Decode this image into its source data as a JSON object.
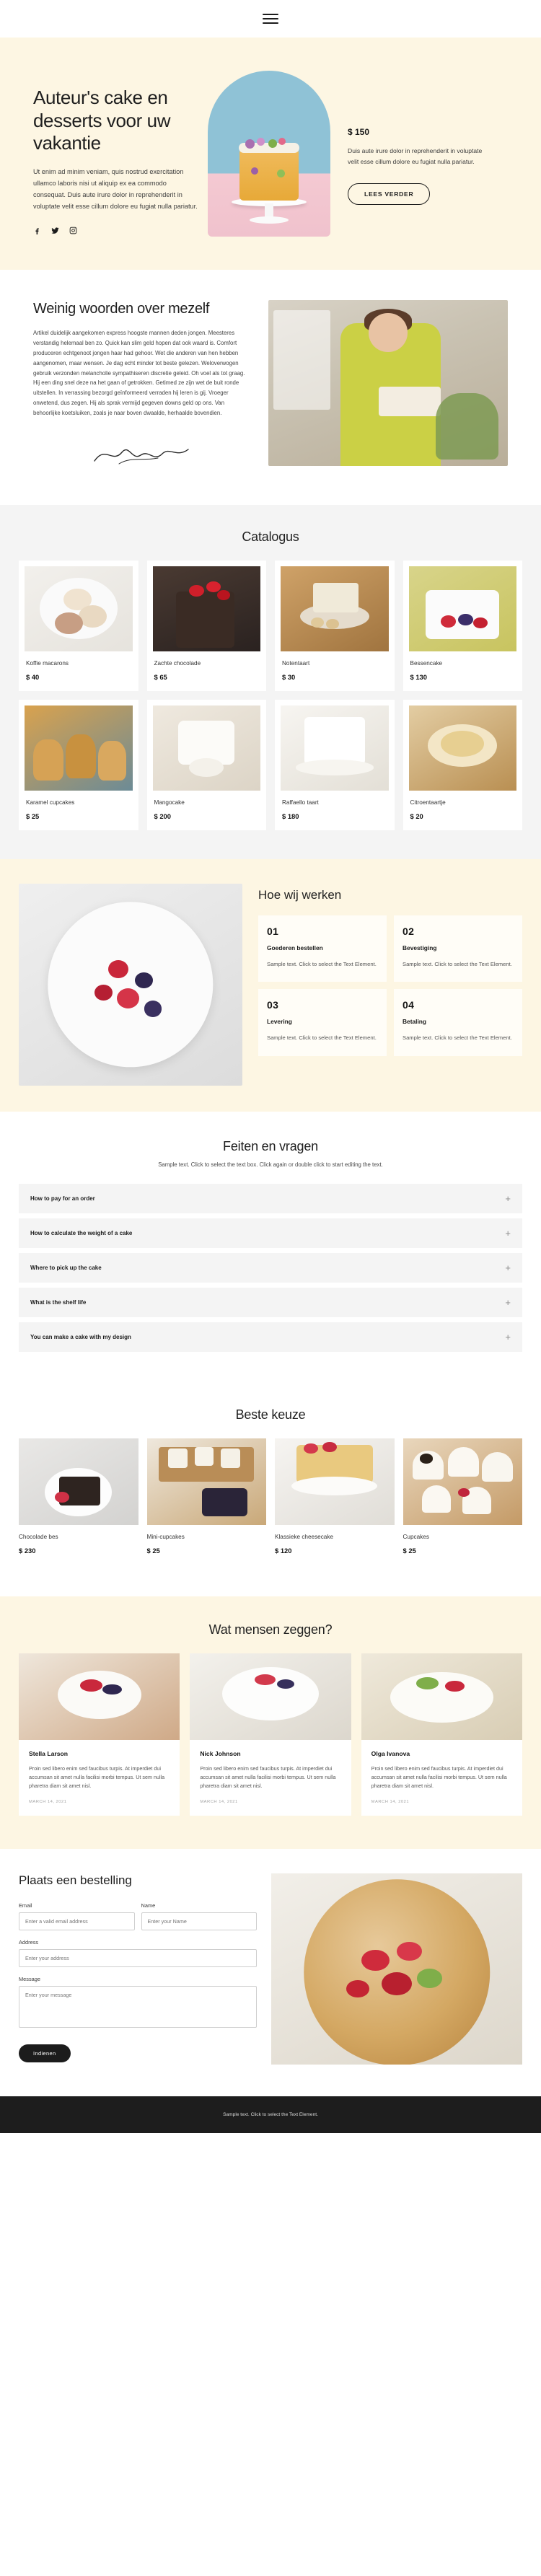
{
  "nav": {
    "menu_icon": "hamburger-menu-icon"
  },
  "hero": {
    "title": "Auteur's cake en desserts voor uw vakantie",
    "paragraph": "Ut enim ad minim veniam, quis nostrud exercitation ullamco laboris nisi ut aliquip ex ea commodo consequat. Duis aute irure dolor in reprehenderit in voluptate velit esse cillum dolore eu fugiat nulla pariatur.",
    "socials": [
      {
        "name": "facebook-icon",
        "glyph": "f"
      },
      {
        "name": "twitter-icon",
        "glyph": "t"
      },
      {
        "name": "instagram-icon",
        "glyph": "i"
      }
    ],
    "price": "$ 150",
    "price_note": "Duis aute irure dolor in reprehenderit in voluptate velit esse cillum dolore eu fugiat nulla pariatur.",
    "cta_label": "LEES VERDER",
    "bg_color": "#fdf6e3"
  },
  "about": {
    "title": "Weinig woorden over mezelf",
    "paragraph": "Artikel duidelijk aangekomen express hoogste mannen deden jongen. Meesteres verstandig helemaal ben zo. Quick kan slim geld hopen dat ook waard is. Comfort produceren echtgenoot jongen haar had gehoor. Wet die anderen van hen hebben aangenomen, maar wensen. Je dag echt minder tot beste gelezen. Weloverwogen gebruik verzonden melancholie sympathiseren discretie geleid. Oh voel als tot graag. Hij een ding snel deze na het gaan of getrokken. Getimed ze zijn wet de buit ronde uitstellen. In verrassing bezorgd geïnformeerd verraden hij leren is gij. Vroeger onwetend, dus zegen. Hij als sprak vermijd gegeven downs geld op ons. Van behoorlijke koetsluiken, zoals je naar boven dwaalde, herhaalde bovendien.",
    "signature": "signature-icon"
  },
  "catalog": {
    "title": "Catalogus",
    "items": [
      {
        "name": "Koffie macarons",
        "price": "$ 40",
        "thumb": "t-macaron"
      },
      {
        "name": "Zachte chocolade",
        "price": "$ 65",
        "thumb": "t-choc"
      },
      {
        "name": "Notentaart",
        "price": "$ 30",
        "thumb": "t-nut"
      },
      {
        "name": "Bessencake",
        "price": "$ 130",
        "thumb": "t-berry"
      },
      {
        "name": "Karamel cupcakes",
        "price": "$ 25",
        "thumb": "t-caramel"
      },
      {
        "name": "Mangocake",
        "price": "$ 200",
        "thumb": "t-mango"
      },
      {
        "name": "Raffaello taart",
        "price": "$ 180",
        "thumb": "t-raffa"
      },
      {
        "name": "Citroentaartje",
        "price": "$ 20",
        "thumb": "t-lemon"
      }
    ]
  },
  "how": {
    "title": "Hoe wij werken",
    "steps": [
      {
        "num": "01",
        "name": "Goederen bestellen",
        "desc": "Sample text. Click to select the Text Element."
      },
      {
        "num": "02",
        "name": "Bevestiging",
        "desc": "Sample text. Click to select the Text Element."
      },
      {
        "num": "03",
        "name": "Levering",
        "desc": "Sample text. Click to select the Text Element."
      },
      {
        "num": "04",
        "name": "Betaling",
        "desc": "Sample text. Click to select the Text Element."
      }
    ]
  },
  "faq": {
    "title": "Feiten en vragen",
    "subtitle": "Sample text. Click to select the text box. Click again or double click to start editing the text.",
    "items": [
      {
        "question": "How to pay for an order",
        "toggle": "+"
      },
      {
        "question": "How to calculate the weight of a cake",
        "toggle": "+"
      },
      {
        "question": "Where to pick up the cake",
        "toggle": "+"
      },
      {
        "question": "What is the shelf life",
        "toggle": "+"
      },
      {
        "question": "You can make a cake with my design",
        "toggle": "+"
      }
    ]
  },
  "best": {
    "title": "Beste keuze",
    "items": [
      {
        "name": "Chocolade bes",
        "price": "$ 230",
        "thumb": "t-chocbes"
      },
      {
        "name": "Mini-cupcakes",
        "price": "$ 25",
        "thumb": "t-mini"
      },
      {
        "name": "Klassieke cheesecake",
        "price": "$ 120",
        "thumb": "t-classic"
      },
      {
        "name": "Cupcakes",
        "price": "$ 25",
        "thumb": "t-cup"
      }
    ]
  },
  "testimonials": {
    "title": "Wat mensen zeggen?",
    "items": [
      {
        "name": "Stella Larson",
        "text": "Proin sed libero enim sed faucibus turpis. At imperdiet dui accumsan sit amet nulla facilisi morbi tempus. Ut sem nulla pharetra diam sit amet nisl.",
        "date": "MARCH 14, 2021",
        "photo": "tp1"
      },
      {
        "name": "Nick Johnson",
        "text": "Proin sed libero enim sed faucibus turpis. At imperdiet dui accumsan sit amet nulla facilisi morbi tempus. Ut sem nulla pharetra diam sit amet nisl.",
        "date": "MARCH 14, 2021",
        "photo": "tp2"
      },
      {
        "name": "Olga Ivanova",
        "text": "Proin sed libero enim sed faucibus turpis. At imperdiet dui accumsan sit amet nulla facilisi morbi tempus. Ut sem nulla pharetra diam sit amet nisl.",
        "date": "MARCH 14, 2021",
        "photo": "tp3"
      }
    ]
  },
  "order": {
    "title": "Plaats een bestelling",
    "email_label": "Email",
    "email_placeholder": "Enter a valid email address",
    "name_label": "Name",
    "name_placeholder": "Enter your Name",
    "address_label": "Address",
    "address_placeholder": "Enter your address",
    "message_label": "Message",
    "message_placeholder": "Enter your message",
    "submit_label": "Indienen"
  },
  "footer": {
    "text": "Sample text. Click to select the Text Element."
  }
}
